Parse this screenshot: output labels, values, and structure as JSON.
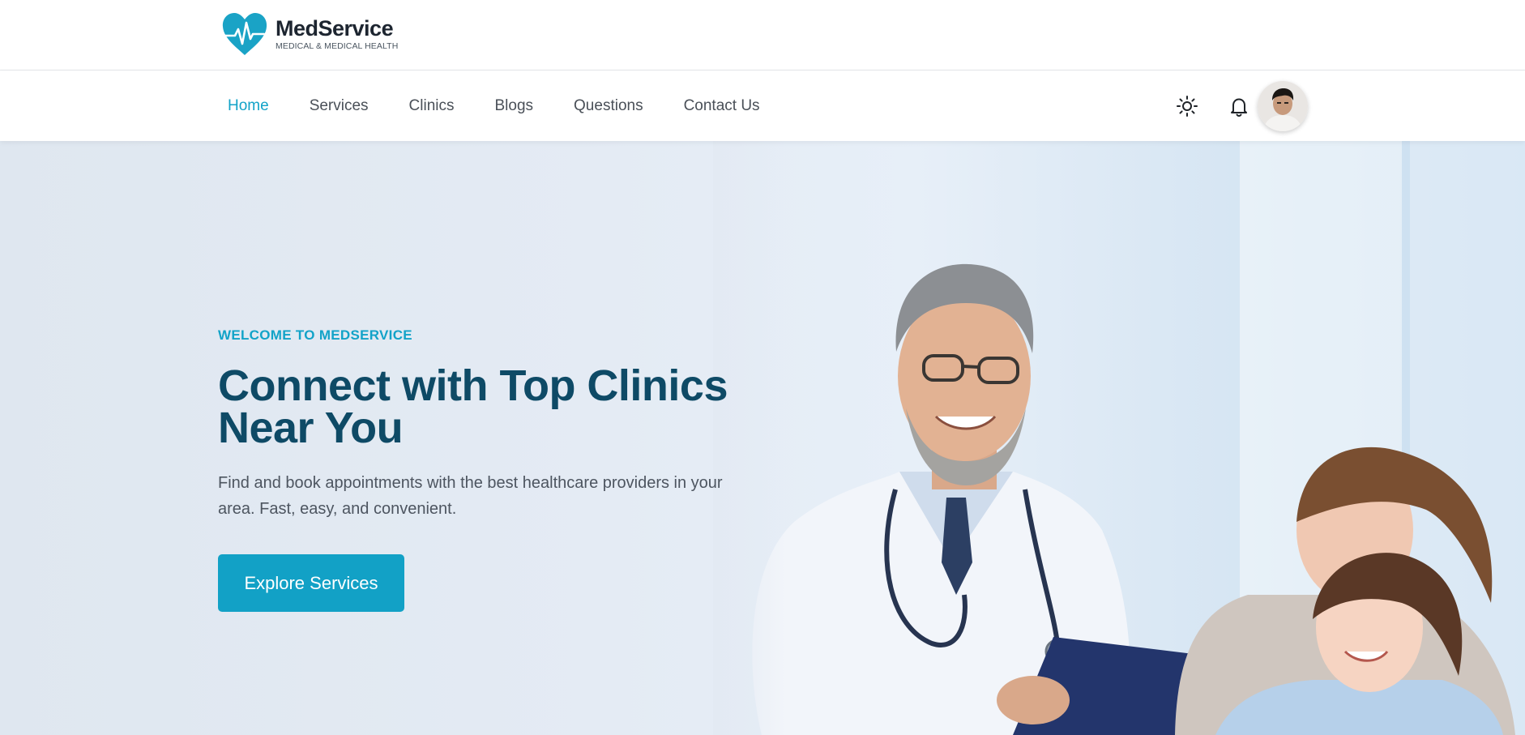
{
  "brand": {
    "name": "MedService",
    "tagline": "MEDICAL & MEDICAL HEALTH",
    "accent_color": "#12a3c8"
  },
  "nav": {
    "items": [
      {
        "label": "Home",
        "active": true
      },
      {
        "label": "Services",
        "active": false
      },
      {
        "label": "Clinics",
        "active": false
      },
      {
        "label": "Blogs",
        "active": false
      },
      {
        "label": "Questions",
        "active": false
      },
      {
        "label": "Contact Us",
        "active": false
      }
    ],
    "actions": {
      "theme_toggle_icon": "sun-icon",
      "notifications_icon": "bell-icon",
      "avatar": "user-avatar"
    }
  },
  "hero": {
    "eyebrow": "WELCOME TO MEDSERVICE",
    "headline_line1": "Connect with Top Clinics",
    "headline_line2": "Near You",
    "subtext": "Find and book appointments with the best healthcare providers in your area. Fast, easy, and convenient.",
    "cta_label": "Explore Services",
    "cta_color": "#12a1c6",
    "headline_color": "#0e4a66"
  }
}
